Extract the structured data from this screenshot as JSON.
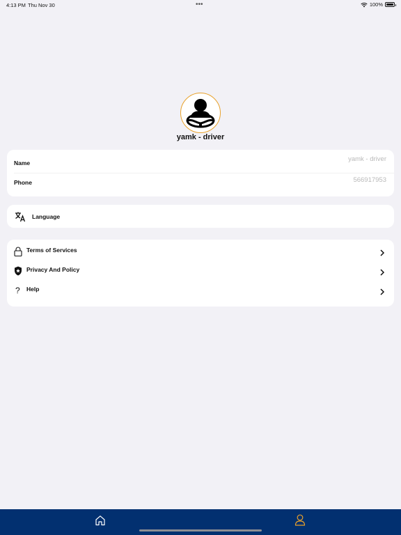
{
  "status_bar": {
    "time": "4:13 PM",
    "date": "Thu Nov 30",
    "dots": "•••",
    "battery": "100%"
  },
  "profile": {
    "name": "yamk - driver",
    "avatar_icon": "driver-steering-wheel-icon",
    "ring_color": "#e8a12b"
  },
  "info": {
    "name_label": "Name",
    "name_value": "yamk - driver",
    "phone_label": "Phone",
    "phone_value": "566917953"
  },
  "settings": {
    "language_label": "Language",
    "language_icon": "translate-icon"
  },
  "links": [
    {
      "label": "Terms of Services",
      "icon": "lock-icon"
    },
    {
      "label": "Privacy And Policy",
      "icon": "shield-icon"
    },
    {
      "label": "Help",
      "icon": "question-icon"
    }
  ],
  "tab_bar": {
    "background": "#023070",
    "active_color": "#e8a12b",
    "items": [
      {
        "name": "home",
        "icon": "home-icon",
        "active": false
      },
      {
        "name": "profile",
        "icon": "person-icon",
        "active": true
      }
    ]
  }
}
